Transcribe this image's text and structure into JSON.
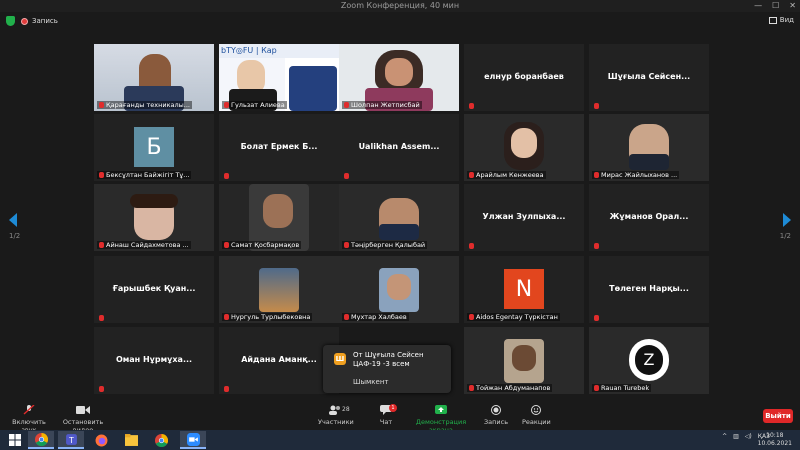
{
  "window": {
    "title": "Zoom Конференция, 40 мин"
  },
  "topbar": {
    "recording_label": "Запись",
    "view_label": "Вид"
  },
  "pagination": {
    "left": "1/2",
    "right": "1/2"
  },
  "colors": {
    "active_speaker": "#a6d64a",
    "muted_mic": "#e02c2c",
    "leave": "#e02828",
    "screen_share": "#21b04b",
    "nav_arrow": "#1e8bd6"
  },
  "tiles": [
    {
      "name": "Қарағанды техникалы...",
      "type": "video"
    },
    {
      "name": "Гульзат Алиева",
      "type": "video"
    },
    {
      "name": "Шолпан Жетписбай",
      "type": "video",
      "speaking": true
    },
    {
      "name": "",
      "type": "text",
      "display": "елнур боранбаев"
    },
    {
      "name": "",
      "type": "text",
      "display": "Шұғыла Сейсен..."
    },
    {
      "name": "Бексұлтан Байжігіт Тұ...",
      "type": "letter",
      "letter": "Б",
      "bg": "#5f8fa3"
    },
    {
      "name": "",
      "type": "text",
      "display": "Болат Ермек Б..."
    },
    {
      "name": "",
      "type": "text",
      "display": "Ualikhan Assem..."
    },
    {
      "name": "Арайлым Кенжеева",
      "type": "video"
    },
    {
      "name": "Мирас Жайлыханов ...",
      "type": "video"
    },
    {
      "name": "Айнаш Сайдахметова ...",
      "type": "video"
    },
    {
      "name": "Самат Қосбармақов",
      "type": "video"
    },
    {
      "name": "Тәңірберген Қалыбай",
      "type": "video"
    },
    {
      "name": "",
      "type": "text",
      "display": "Улжан Зулпыха..."
    },
    {
      "name": "",
      "type": "text",
      "display": "Жұманов Орал..."
    },
    {
      "name": "",
      "type": "text",
      "display": "Ғарышбек Қуан..."
    },
    {
      "name": "Нургуль Турлыбековна",
      "type": "video"
    },
    {
      "name": "Мухтар Халбаев",
      "type": "video"
    },
    {
      "name": "Aidos Egentay Түркістан",
      "type": "letter",
      "letter": "N",
      "bg": "#e2461e"
    },
    {
      "name": "",
      "type": "text",
      "display": "Төлеген Нарқы..."
    },
    {
      "name": "",
      "type": "text",
      "display": "Оман Нұрмұха..."
    },
    {
      "name": "",
      "type": "text",
      "display": "Айдана Аманқ..."
    },
    {
      "name": "",
      "type": "empty"
    },
    {
      "name": "Тойжан Абдуманапов",
      "type": "video"
    },
    {
      "name": "Rauan Turebek",
      "type": "video"
    }
  ],
  "toast": {
    "title": "От Шұғыла Сейсен ЦАФ-19 -3 всем",
    "body": "Шымкент",
    "icon_letter": "Ш"
  },
  "toolbar": {
    "unmute": "Включить звук",
    "start_video": "Остановить видео",
    "participants": "Участники",
    "participants_count": "28",
    "chat": "Чат",
    "chat_badge": "1",
    "share": "Демонстрация экрана",
    "record": "Запись",
    "reactions": "Реакции",
    "leave": "Выйти"
  },
  "taskbar": {
    "lang": "ҚАЗ",
    "time": "10:18",
    "date": "10.06.2021"
  }
}
